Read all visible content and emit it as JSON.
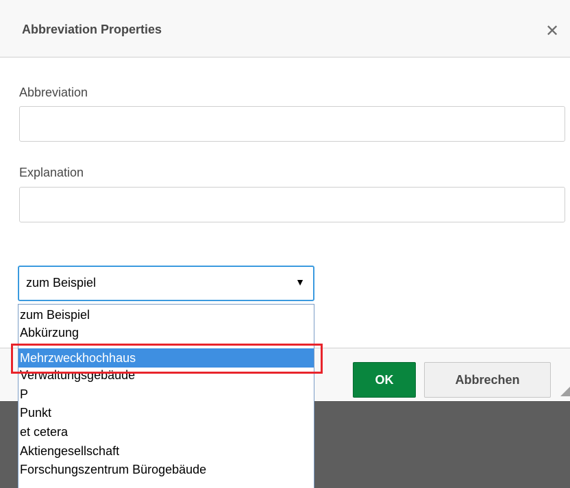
{
  "dialog": {
    "title": "Abbreviation Properties",
    "close_glyph": "✕",
    "abbreviation_label": "Abbreviation",
    "abbreviation_value": "",
    "explanation_label": "Explanation",
    "explanation_value": "",
    "ok_label": "OK",
    "cancel_label": "Abbrechen"
  },
  "select": {
    "value": "zum Beispiel",
    "arrow_glyph": "▼",
    "selected_index": 2,
    "options": [
      "zum Beispiel",
      "Abkürzung",
      "Mehrzweckhochhaus",
      "Verwaltungsgebäude",
      "P",
      "Punkt",
      "et cetera",
      "Aktiengesellschaft",
      "Forschungszentrum Bürogebäude"
    ]
  },
  "colors": {
    "ok_button": "#09863e",
    "selected_option": "#3e8fe1",
    "highlight_box": "#e8242b",
    "focus_border": "#3a9adf"
  }
}
